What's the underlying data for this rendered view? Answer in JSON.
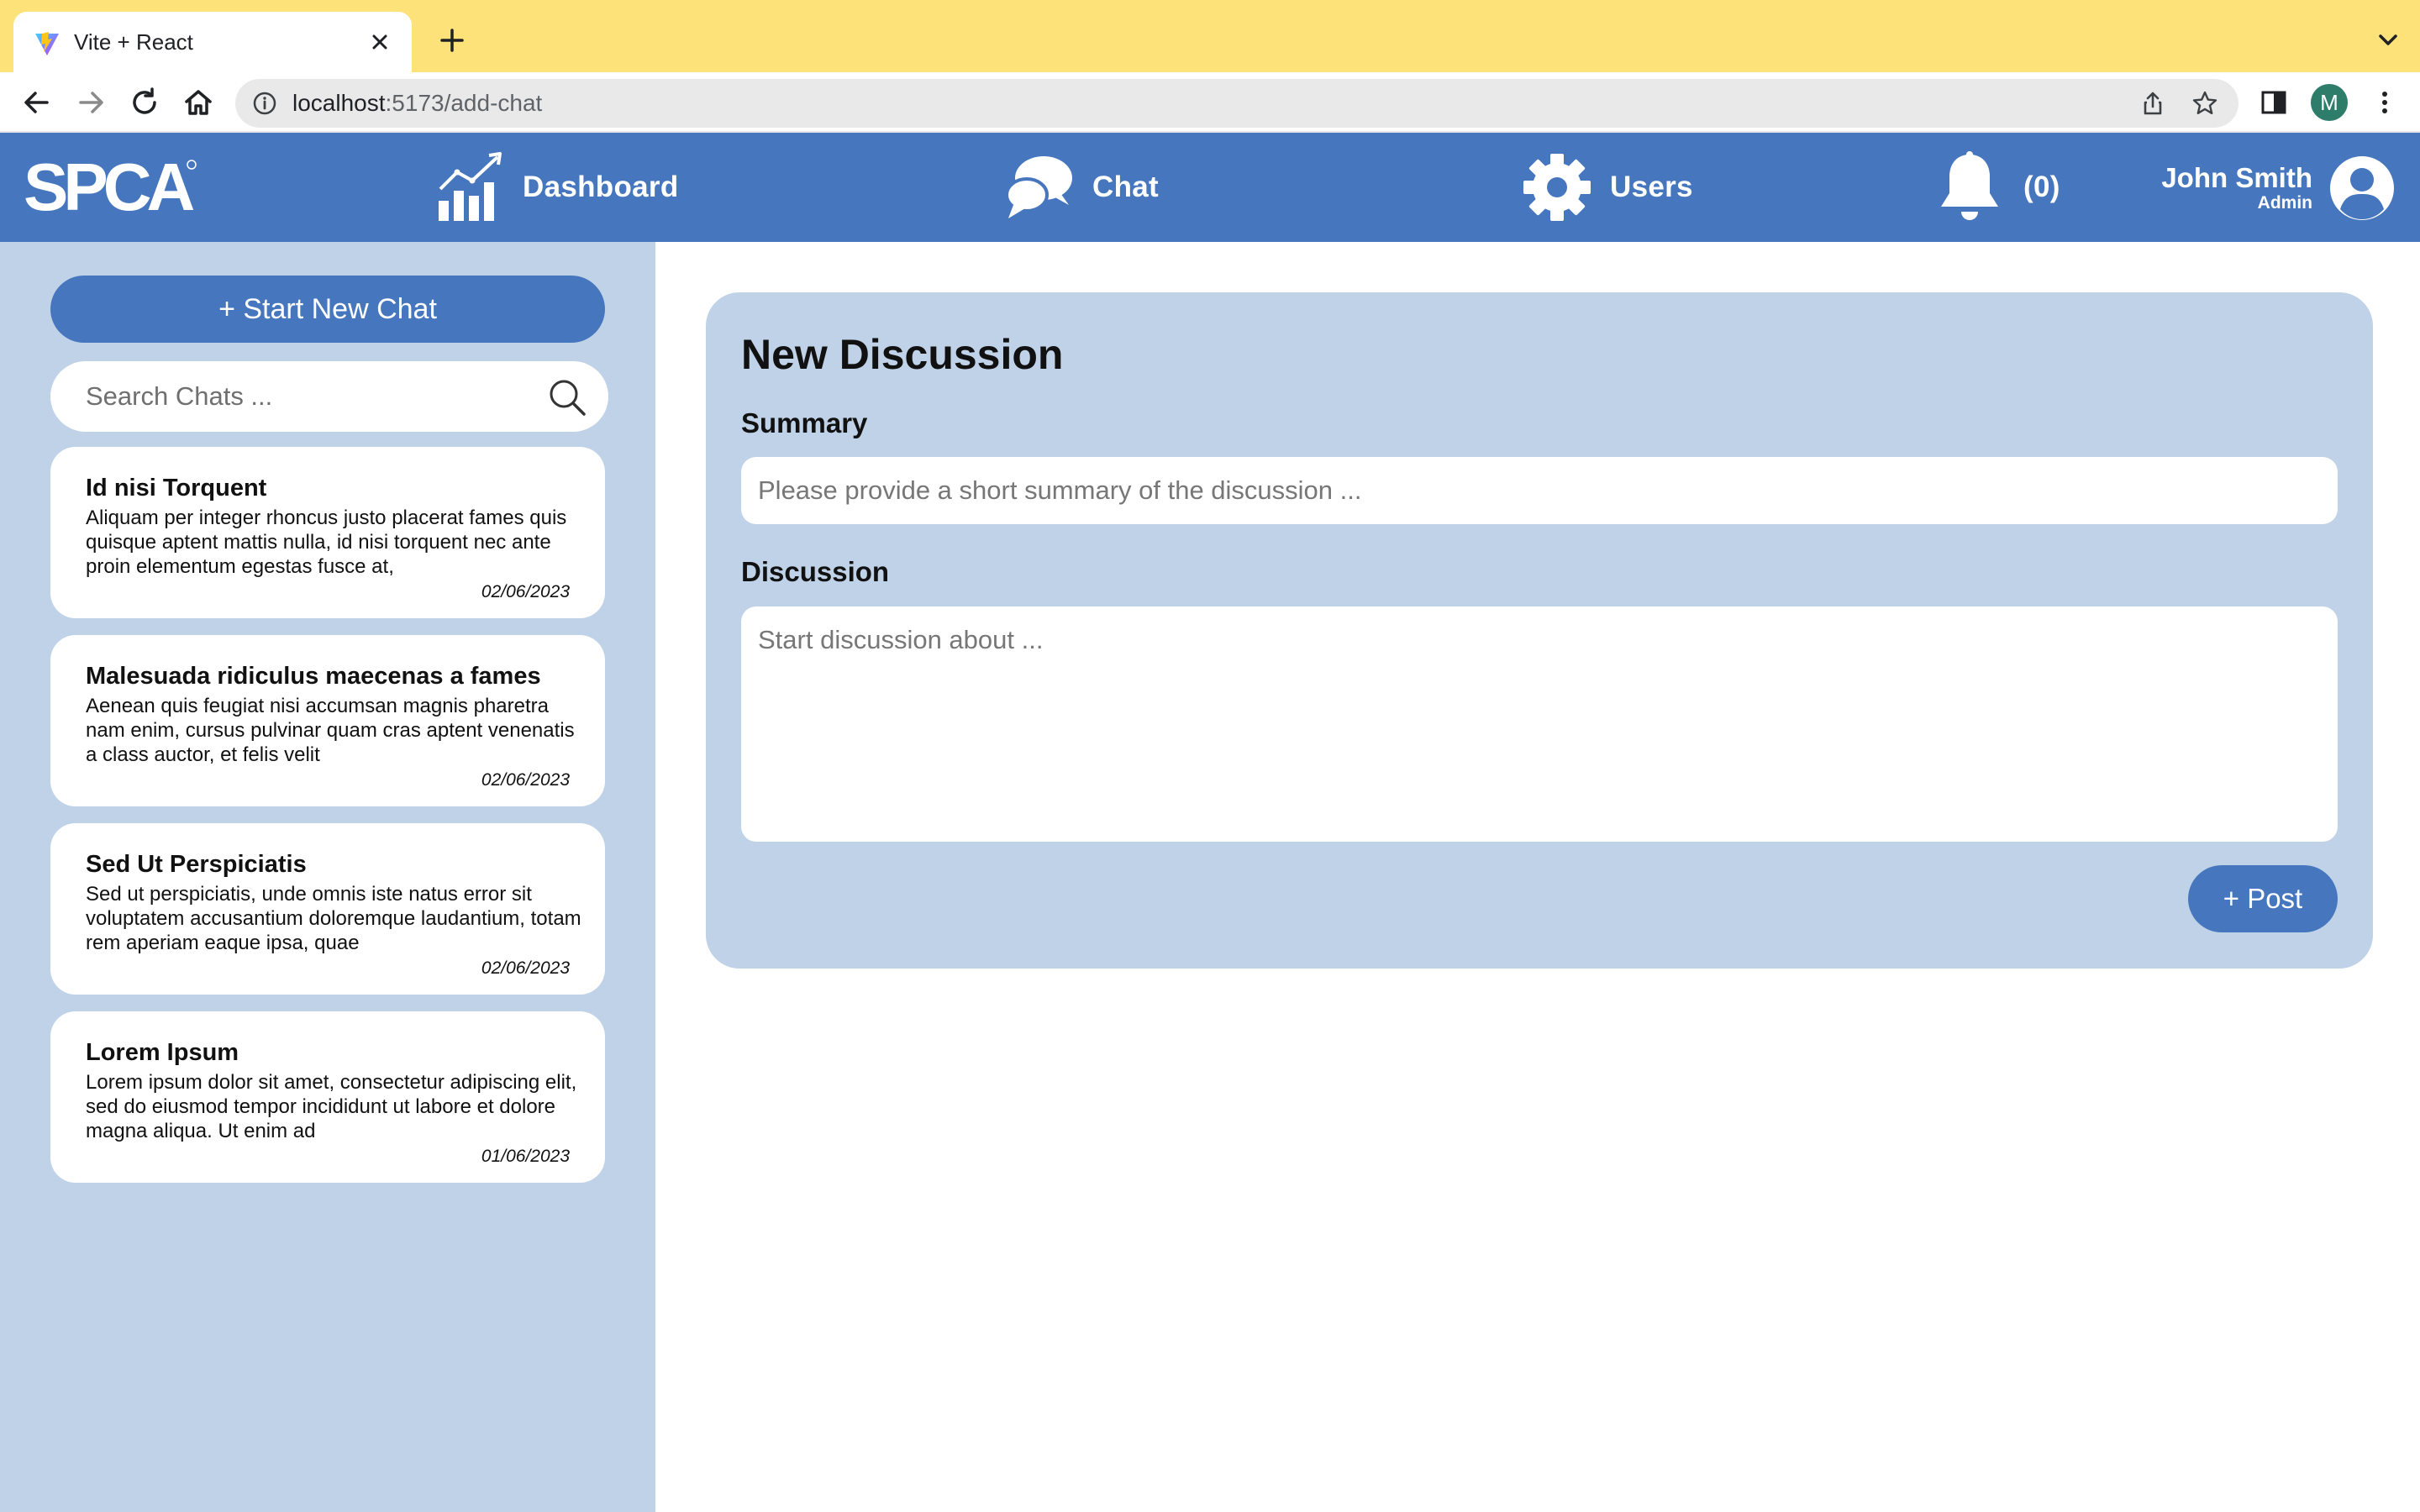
{
  "browser": {
    "tab_title": "Vite + React",
    "url_host": "localhost",
    "url_path": ":5173/add-chat",
    "profile_initial": "M"
  },
  "header": {
    "logo_text": "SPCA",
    "nav": {
      "dashboard": "Dashboard",
      "chat": "Chat",
      "users": "Users",
      "notifications_count": "(0)"
    },
    "user": {
      "name": "John Smith",
      "role": "Admin"
    }
  },
  "sidebar": {
    "start_chat_label": "+ Start New Chat",
    "search_placeholder": "Search Chats ...",
    "chats": [
      {
        "title": "Id nisi Torquent",
        "preview": "Aliquam per integer rhoncus justo placerat fames quis quisque aptent mattis nulla, id nisi torquent nec ante proin elementum egestas fusce at,",
        "date": "02/06/2023"
      },
      {
        "title": "Malesuada ridiculus maecenas a fames",
        "preview": "Aenean quis feugiat nisi accumsan magnis pharetra nam enim, cursus pulvinar quam cras aptent venenatis a class auctor, et felis velit",
        "date": "02/06/2023"
      },
      {
        "title": "Sed Ut Perspiciatis",
        "preview": "Sed ut perspiciatis, unde omnis iste natus error sit voluptatem accusantium doloremque laudantium, totam rem aperiam eaque ipsa, quae",
        "date": "02/06/2023"
      },
      {
        "title": "Lorem Ipsum",
        "preview": "Lorem ipsum dolor sit amet, consectetur adipiscing elit, sed do eiusmod tempor incididunt ut labore et dolore magna aliqua. Ut enim ad",
        "date": "01/06/2023"
      }
    ]
  },
  "main": {
    "title": "New Discussion",
    "summary_label": "Summary",
    "summary_placeholder": "Please provide a short summary of the discussion ...",
    "summary_value": "",
    "discussion_label": "Discussion",
    "discussion_placeholder": "Start discussion about ...",
    "discussion_value": "",
    "post_label": "+ Post"
  },
  "colors": {
    "tab_strip": "#fde27a",
    "header_blue": "#4677be",
    "sidebar_bg": "#c0d2e8",
    "panel_bg": "#c0d2e8",
    "profile_green": "#2e7d6b"
  },
  "icons": {
    "tab": [
      "vite-favicon-icon",
      "close-icon",
      "plus-icon",
      "chevron-down-icon"
    ],
    "toolbar": [
      "back-arrow-icon",
      "forward-arrow-icon",
      "reload-icon",
      "home-icon",
      "info-icon",
      "share-icon",
      "star-icon",
      "side-panel-icon",
      "kebab-menu-icon"
    ],
    "header": [
      "bar-chart-icon",
      "chat-bubbles-icon",
      "gear-icon",
      "bell-icon",
      "user-circle-icon"
    ],
    "sidebar": [
      "search-icon"
    ]
  }
}
